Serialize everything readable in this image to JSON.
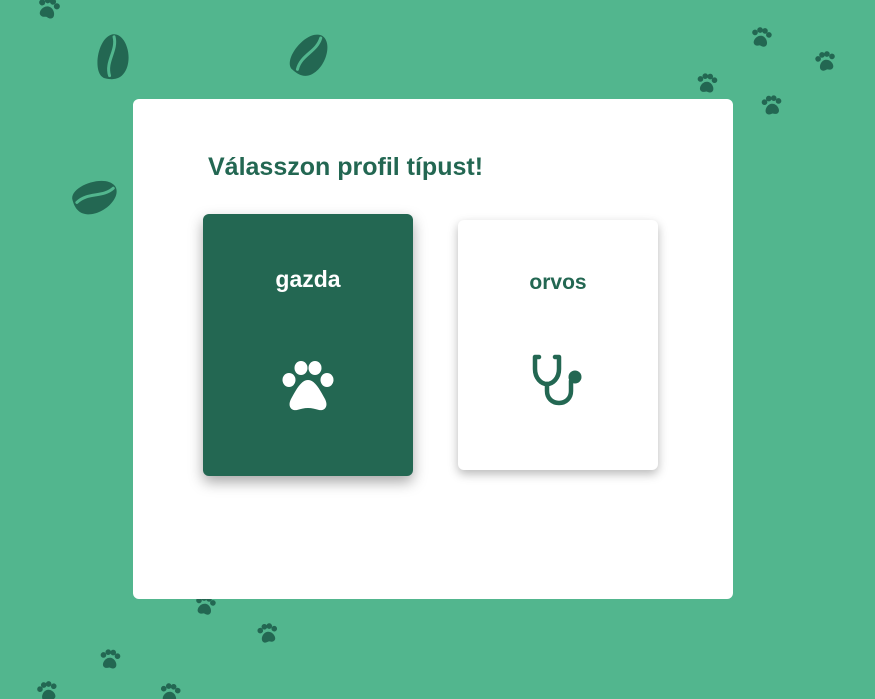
{
  "page": {
    "title": "Válasszon profil típust!"
  },
  "options": [
    {
      "label": "gazda",
      "icon": "paw-icon",
      "selected": true
    },
    {
      "label": "orvos",
      "icon": "stethoscope-icon",
      "selected": false
    }
  ],
  "colors": {
    "background": "#52b68e",
    "primary": "#236752",
    "card": "#ffffff",
    "decoration": "#236752"
  },
  "decorations": {
    "pattern": "paw-prints-and-pill-shapes"
  }
}
